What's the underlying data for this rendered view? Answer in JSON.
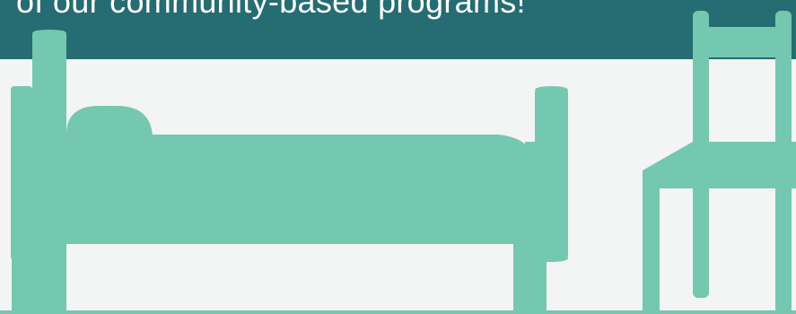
{
  "banner": {
    "text": "of our community-based programs!"
  },
  "colors": {
    "banner_background": "#266c73",
    "page_background": "#f3f4f4",
    "illustration": "#74c8af",
    "banner_text": "#ffffff"
  },
  "illustration": {
    "items": [
      "bed-icon",
      "chair-icon"
    ]
  }
}
